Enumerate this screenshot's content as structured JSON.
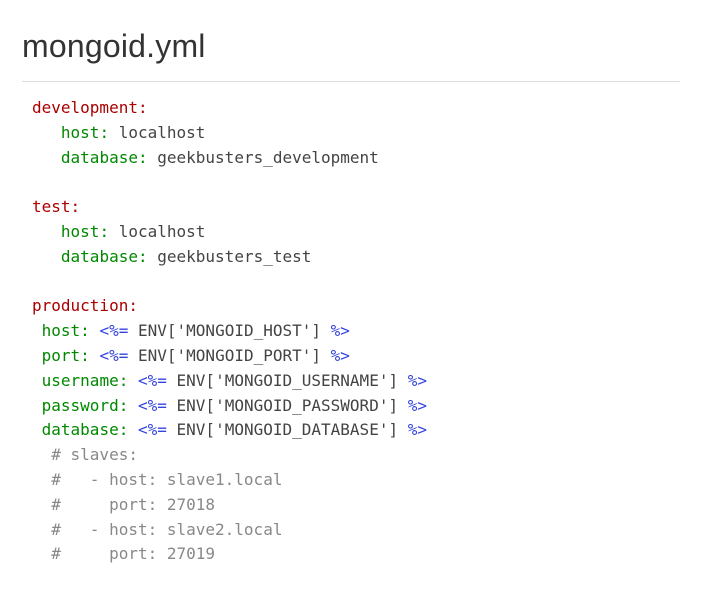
{
  "title": "mongoid.yml",
  "code": {
    "dev": {
      "env": "development:",
      "host_k": "host:",
      "host_v": "localhost",
      "db_k": "database:",
      "db_v": "geekbusters_development"
    },
    "test": {
      "env": "test:",
      "host_k": "host:",
      "host_v": "localhost",
      "db_k": "database:",
      "db_v": "geekbusters_test"
    },
    "prod": {
      "env": "production:",
      "host_k": "host:",
      "host_erb_open": "<%=",
      "host_mid": "ENV['MONGOID_HOST']",
      "host_erb_close": "%>",
      "port_k": "port:",
      "port_erb_open": "<%=",
      "port_mid": "ENV['MONGOID_PORT']",
      "port_erb_close": "%>",
      "user_k": "username:",
      "user_erb_open": "<%=",
      "user_mid": "ENV['MONGOID_USERNAME']",
      "user_erb_close": "%>",
      "pass_k": "password:",
      "pass_erb_open": "<%=",
      "pass_mid": "ENV['MONGOID_PASSWORD']",
      "pass_erb_close": "%>",
      "db_k": "database:",
      "db_erb_open": "<%=",
      "db_mid": "ENV['MONGOID_DATABASE']",
      "db_erb_close": "%>",
      "c1": "# slaves:",
      "c2": "#   - host: slave1.local",
      "c3": "#     port: 27018",
      "c4": "#   - host: slave2.local",
      "c5": "#     port: 27019"
    }
  }
}
